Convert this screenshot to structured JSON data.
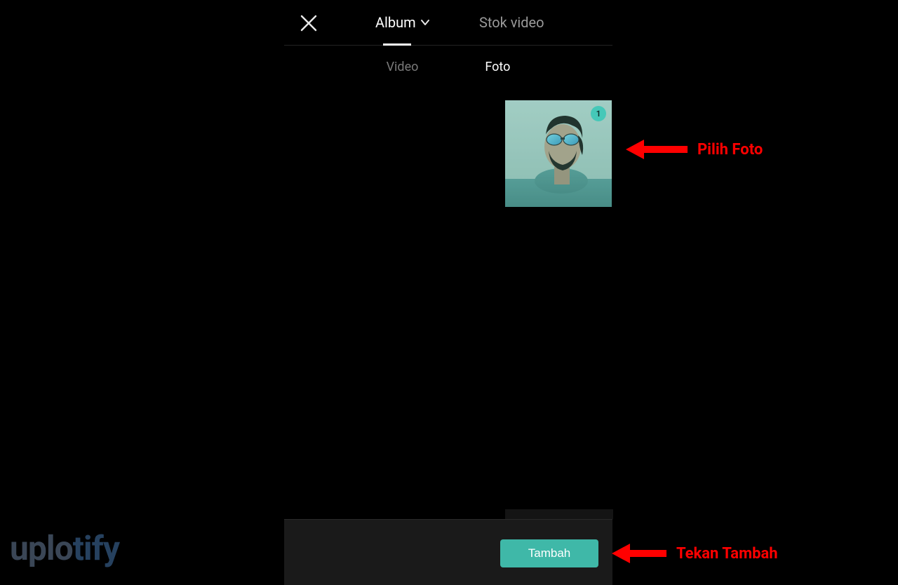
{
  "topbar": {
    "tabs": {
      "album": "Album",
      "stok": "Stok video"
    }
  },
  "subtabs": {
    "video": "Video",
    "foto": "Foto"
  },
  "thumbnail": {
    "selection_index": "1"
  },
  "bottom": {
    "add_label": "Tambah"
  },
  "annotations": {
    "pilih_foto": "Pilih Foto",
    "tekan_tambah": "Tekan Tambah"
  },
  "watermark": {
    "part1": "uplo",
    "part2": "tify"
  },
  "colors": {
    "accent": "#3fb8a8",
    "annotation": "#ff0000"
  }
}
